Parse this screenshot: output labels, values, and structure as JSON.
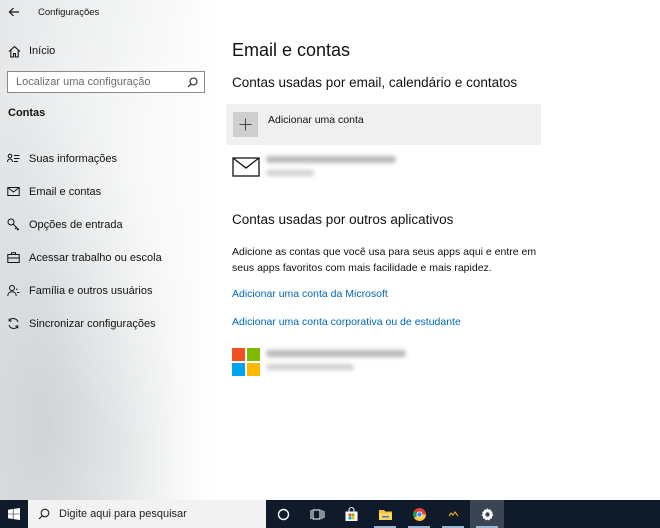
{
  "window": {
    "title": "Configurações"
  },
  "sidebar": {
    "home_label": "Início",
    "search_placeholder": "Localizar uma configuração",
    "section_title": "Contas",
    "items": [
      {
        "label": "Suas informações",
        "icon": "person-card-icon"
      },
      {
        "label": "Email e contas",
        "icon": "mail-icon"
      },
      {
        "label": "Opções de entrada",
        "icon": "key-icon"
      },
      {
        "label": "Acessar trabalho ou escola",
        "icon": "briefcase-icon"
      },
      {
        "label": "Família e outros usuários",
        "icon": "people-icon"
      },
      {
        "label": "Sincronizar configurações",
        "icon": "sync-icon"
      }
    ]
  },
  "main": {
    "title": "Email e contas",
    "section1_title": "Contas usadas por email, calendário e contatos",
    "add_account_label": "Adicionar uma conta",
    "section2_title": "Contas usadas por outros aplicativos",
    "section2_description": "Adicione as contas que você usa para seus apps aqui e entre em seus apps favoritos com mais facilidade e mais rapidez.",
    "link_microsoft": "Adicionar uma conta da Microsoft",
    "link_work": "Adicionar uma conta corporativa ou de estudante"
  },
  "taskbar": {
    "search_placeholder": "Digite aqui para pesquisar",
    "icons": [
      "cortana-circle-icon",
      "task-view-icon",
      "store-icon",
      "file-explorer-icon",
      "chrome-icon",
      "app-icon",
      "settings-gear-icon"
    ]
  },
  "colors": {
    "accent_link": "#0067b8",
    "taskbar_bg": "#0f1b2b",
    "ms_red": "#f25022",
    "ms_green": "#7fba00",
    "ms_blue": "#00a4ef",
    "ms_yellow": "#ffb900"
  }
}
